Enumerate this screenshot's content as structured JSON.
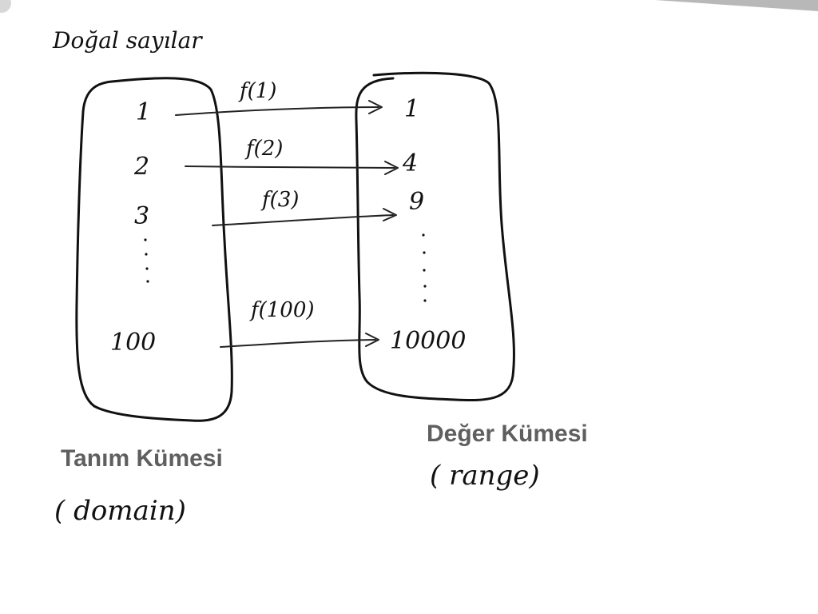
{
  "title": "Doğal sayılar",
  "domain_box": {
    "items": [
      "1",
      "2",
      "3",
      "100"
    ],
    "label": "Tanım Kümesi",
    "sublabel": "( domain)"
  },
  "range_box": {
    "items": [
      "1",
      "4",
      "9",
      "10000"
    ],
    "label": "Değer Kümesi",
    "sublabel": "( range)"
  },
  "mappings": [
    "f(1)",
    "f(2)",
    "f(3)",
    "f(100)"
  ],
  "colors": {
    "ink": "#111111",
    "printed_label": "#5f5f5f",
    "paper": "#ffffff"
  }
}
